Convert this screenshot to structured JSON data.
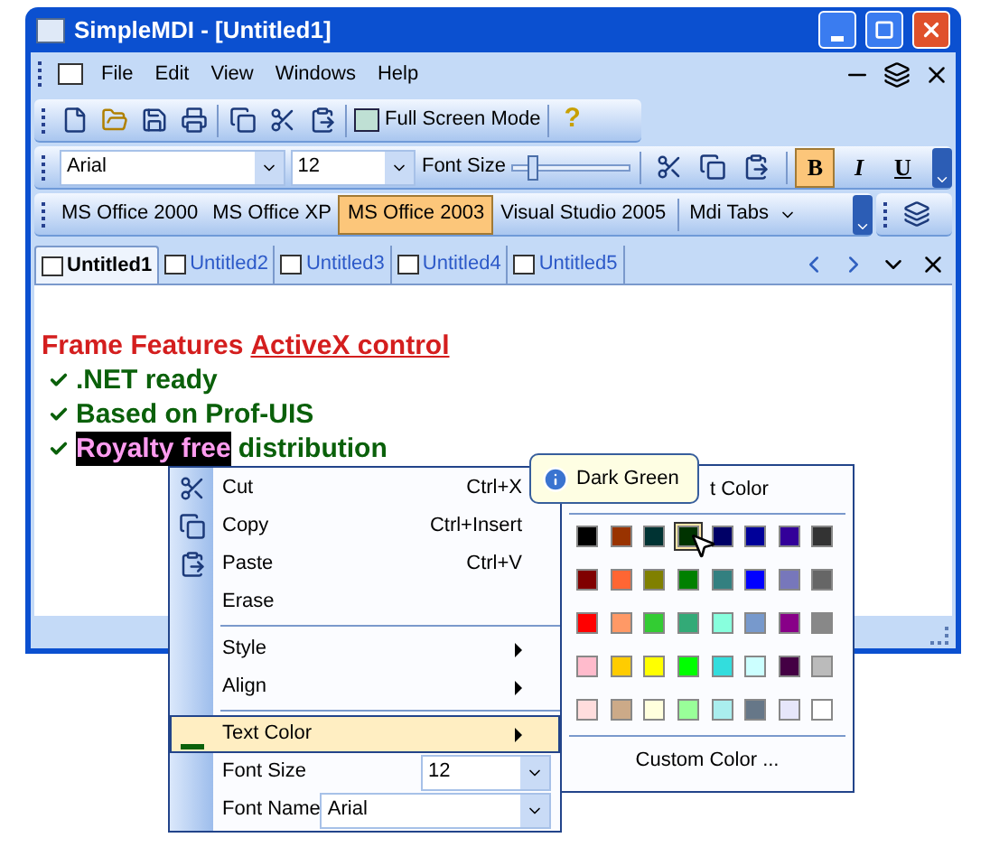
{
  "window": {
    "title": "SimpleMDI - [Untitled1]"
  },
  "menu": [
    "File",
    "Edit",
    "View",
    "Windows",
    "Help"
  ],
  "standard_toolbar": {
    "full_screen_button": "Full Screen Mode",
    "help_button": "?"
  },
  "format_toolbar": {
    "font_name": "Arial",
    "font_size": "12",
    "slider_label": "Font Size",
    "slider": {
      "level": 0.15
    },
    "styles": [
      {
        "label": "B",
        "selected": true
      },
      {
        "label": "I",
        "selected": false
      },
      {
        "label": "U",
        "selected": false
      }
    ]
  },
  "theme_toolbar": {
    "themes": [
      {
        "label": "MS Office 2000",
        "selected": false
      },
      {
        "label": "MS Office XP",
        "selected": false
      },
      {
        "label": "MS Office 2003",
        "selected": true
      },
      {
        "label": "Visual Studio 2005",
        "selected": false
      }
    ],
    "mdi_tabs": "Mdi Tabs"
  },
  "tabs": [
    {
      "label": "Untitled1",
      "selected": true
    },
    {
      "label": "Untitled2",
      "selected": false
    },
    {
      "label": "Untitled3",
      "selected": false
    },
    {
      "label": "Untitled4",
      "selected": false
    },
    {
      "label": "Untitled5",
      "selected": false
    }
  ],
  "document": {
    "lines": [
      {
        "kind": "heading",
        "segments": [
          {
            "text": "Frame Features",
            "link": false
          },
          {
            "text": "ActiveX control",
            "link": true
          }
        ]
      },
      {
        "kind": "bullet",
        "segments": [
          {
            "text": ".NET ready",
            "highlighted": false
          }
        ]
      },
      {
        "kind": "bullet",
        "segments": [
          {
            "text": "Based on Prof-UIS",
            "highlighted": false
          }
        ]
      },
      {
        "kind": "bullet",
        "segments": [
          {
            "text": "Royalty free",
            "highlighted": true
          },
          {
            "text": "distribution",
            "highlighted": false
          }
        ]
      }
    ]
  },
  "context_menu": {
    "items": [
      {
        "kind": "command",
        "label": "Cut",
        "shortcut": "Ctrl+X",
        "selected": false
      },
      {
        "kind": "command",
        "label": "Copy",
        "shortcut": "Ctrl+Insert",
        "selected": false
      },
      {
        "kind": "command",
        "label": "Paste",
        "shortcut": "Ctrl+V",
        "selected": false
      },
      {
        "kind": "command",
        "label": "Erase",
        "selected": false
      },
      {
        "kind": "separator"
      },
      {
        "kind": "submenu",
        "label": "Style",
        "selected": false
      },
      {
        "kind": "submenu",
        "label": "Align",
        "selected": false
      },
      {
        "kind": "separator"
      },
      {
        "kind": "submenu",
        "label": "Text Color",
        "selected": true
      },
      {
        "kind": "combo",
        "label": "Font Size",
        "value": "12",
        "selected": false
      },
      {
        "kind": "combo",
        "label": "Font Name",
        "value": "Arial",
        "selected": false
      }
    ]
  },
  "color_popup": {
    "header": "t Color",
    "custom": "Custom Color ...",
    "colors": [
      {
        "color": "#000000",
        "selected": false
      },
      {
        "color": "#993300",
        "selected": false
      },
      {
        "color": "#003333",
        "selected": false
      },
      {
        "color": "#003300",
        "selected": true
      },
      {
        "color": "#000066",
        "selected": false
      },
      {
        "color": "#000099",
        "selected": false
      },
      {
        "color": "#330099",
        "selected": false
      },
      {
        "color": "#333333",
        "selected": false
      },
      {
        "color": "#800000",
        "selected": false
      },
      {
        "color": "#ff6633",
        "selected": false
      },
      {
        "color": "#808000",
        "selected": false
      },
      {
        "color": "#008000",
        "selected": false
      },
      {
        "color": "#338080",
        "selected": false
      },
      {
        "color": "#0000ff",
        "selected": false
      },
      {
        "color": "#7777bb",
        "selected": false
      },
      {
        "color": "#666666",
        "selected": false
      },
      {
        "color": "#ff0000",
        "selected": false
      },
      {
        "color": "#ff9966",
        "selected": false
      },
      {
        "color": "#33cc33",
        "selected": false
      },
      {
        "color": "#33aa77",
        "selected": false
      },
      {
        "color": "#88ffdd",
        "selected": false
      },
      {
        "color": "#7799cc",
        "selected": false
      },
      {
        "color": "#880088",
        "selected": false
      },
      {
        "color": "#888888",
        "selected": false
      },
      {
        "color": "#ffbbcc",
        "selected": false
      },
      {
        "color": "#ffcc00",
        "selected": false
      },
      {
        "color": "#ffff00",
        "selected": false
      },
      {
        "color": "#00ff00",
        "selected": false
      },
      {
        "color": "#33dddd",
        "selected": false
      },
      {
        "color": "#ccffff",
        "selected": false
      },
      {
        "color": "#440044",
        "selected": false
      },
      {
        "color": "#bbbbbb",
        "selected": false
      },
      {
        "color": "#ffdddd",
        "selected": false
      },
      {
        "color": "#ccaa88",
        "selected": false
      },
      {
        "color": "#ffffdd",
        "selected": false
      },
      {
        "color": "#99ff99",
        "selected": false
      },
      {
        "color": "#aaeeee",
        "selected": false
      },
      {
        "color": "#667788",
        "selected": false
      },
      {
        "color": "#e6e6fa",
        "selected": false
      },
      {
        "color": "#ffffff",
        "selected": false
      }
    ]
  },
  "tooltip": {
    "text": "Dark Green"
  }
}
